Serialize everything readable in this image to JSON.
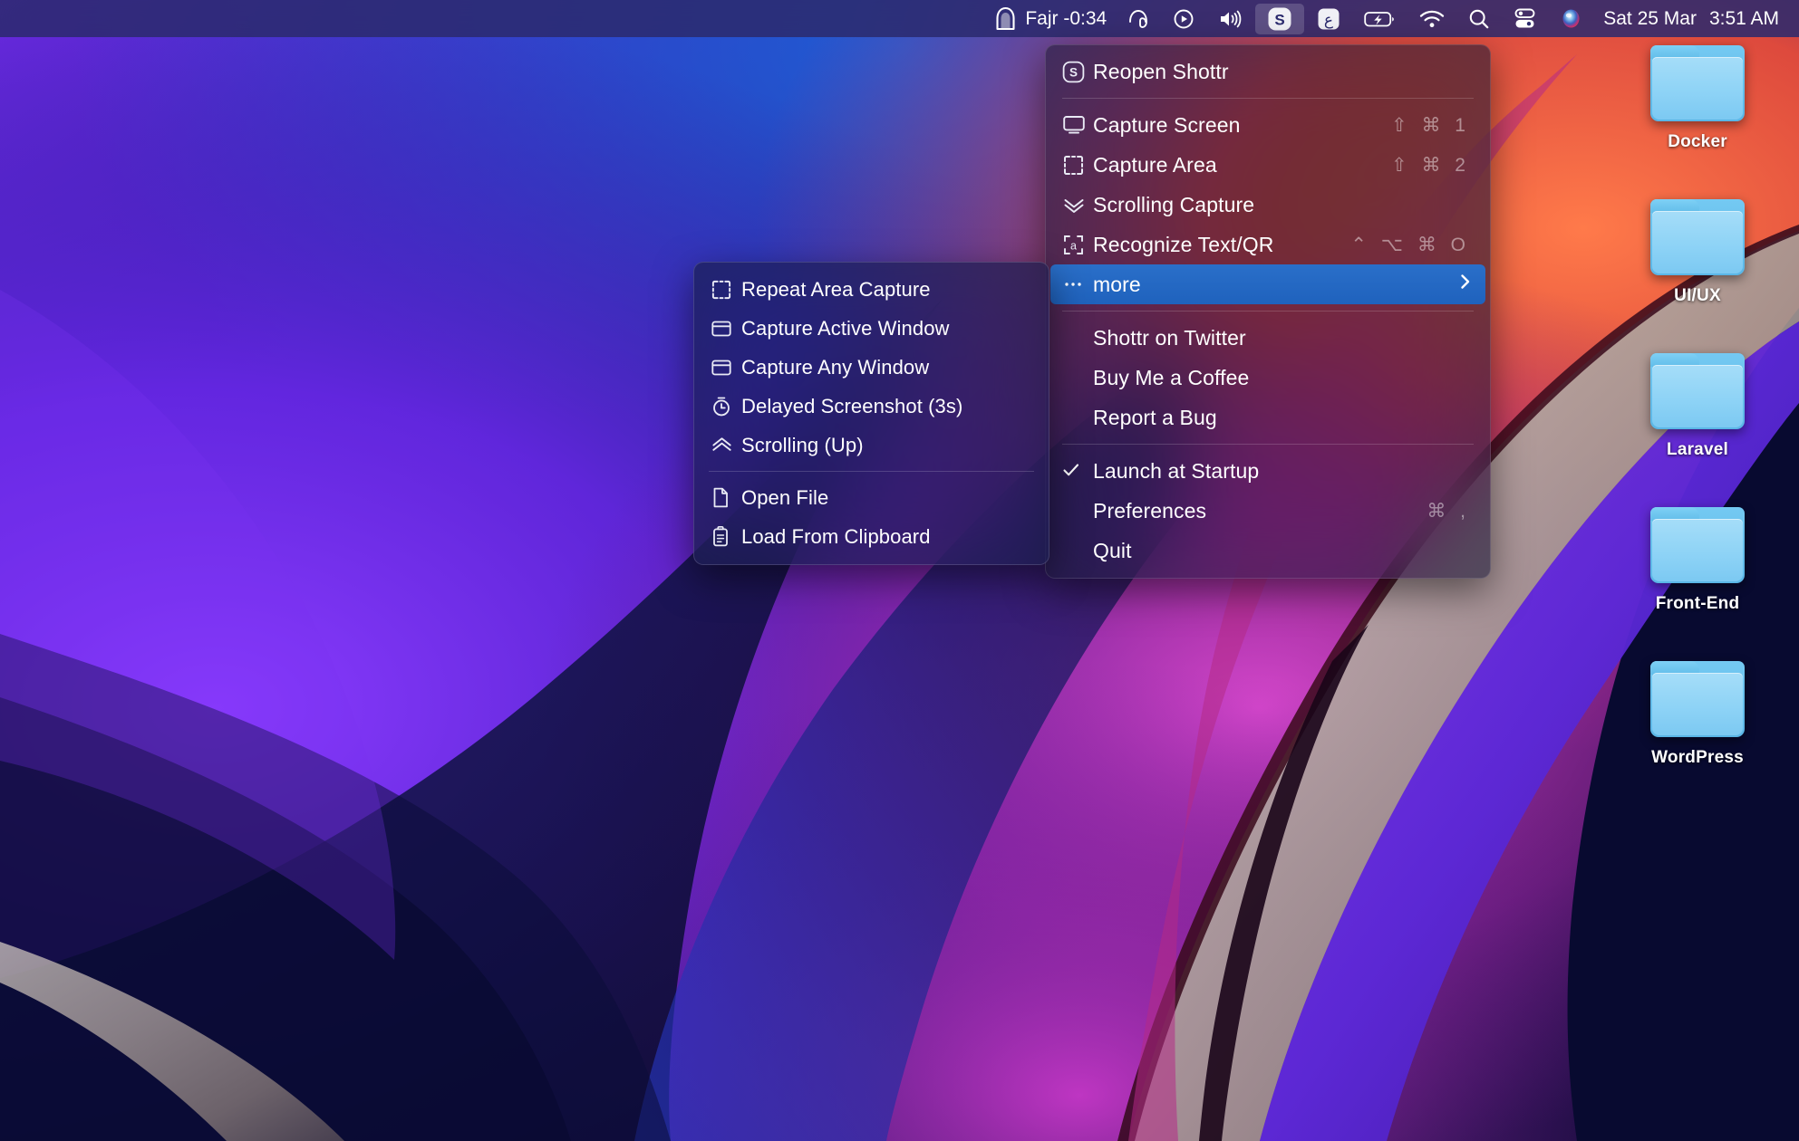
{
  "menubar": {
    "prayer": {
      "icon": "mosque-arch-icon",
      "label": "Fajr -0:34"
    },
    "icons": [
      {
        "name": "headphones-icon",
        "label": "headphones"
      },
      {
        "name": "play-circle-icon",
        "label": "play"
      },
      {
        "name": "volume-icon",
        "label": "volume"
      },
      {
        "name": "shottr-icon",
        "label": "S",
        "active": true
      },
      {
        "name": "arabic-ain-icon",
        "label": "ع"
      },
      {
        "name": "battery-charging-icon",
        "label": "battery"
      },
      {
        "name": "wifi-icon",
        "label": "wifi"
      },
      {
        "name": "spotlight-search-icon",
        "label": "search"
      },
      {
        "name": "control-center-icon",
        "label": "control center"
      },
      {
        "name": "siri-icon",
        "label": "siri"
      }
    ],
    "date": "Sat 25 Mar",
    "time": "3:51 AM"
  },
  "shottr_menu": {
    "items": [
      {
        "id": "reopen-shottr",
        "icon": "shottr-rounded-s-icon",
        "label": "Reopen Shottr",
        "shortcut": ""
      },
      {
        "id": "separator-1",
        "type": "separator"
      },
      {
        "id": "capture-screen",
        "icon": "display-icon",
        "label": "Capture Screen",
        "shortcut": "⇧ ⌘ 1"
      },
      {
        "id": "capture-area",
        "icon": "crop-marks-icon",
        "label": "Capture Area",
        "shortcut": "⇧ ⌘ 2"
      },
      {
        "id": "scrolling-capture",
        "icon": "chevron-double-down-icon",
        "label": "Scrolling Capture",
        "shortcut": ""
      },
      {
        "id": "recognize-text-qr",
        "icon": "text-recognition-icon",
        "label": "Recognize Text/QR",
        "shortcut": "⌃ ⌥ ⌘ O"
      },
      {
        "id": "more",
        "icon": "ellipsis-icon",
        "label": "more",
        "shortcut": "",
        "highlighted": true,
        "has_submenu": true
      },
      {
        "id": "separator-2",
        "type": "separator"
      },
      {
        "id": "shottr-on-twitter",
        "icon": "",
        "label": "Shottr on Twitter",
        "shortcut": ""
      },
      {
        "id": "buy-me-a-coffee",
        "icon": "",
        "label": "Buy Me a Coffee",
        "shortcut": ""
      },
      {
        "id": "report-a-bug",
        "icon": "",
        "label": "Report a Bug",
        "shortcut": ""
      },
      {
        "id": "separator-3",
        "type": "separator"
      },
      {
        "id": "launch-at-startup",
        "icon": "checkmark-icon",
        "label": "Launch at Startup",
        "shortcut": "",
        "checked": true
      },
      {
        "id": "preferences",
        "icon": "",
        "label": "Preferences",
        "shortcut": "⌘ ,"
      },
      {
        "id": "quit",
        "icon": "",
        "label": "Quit",
        "shortcut": ""
      }
    ]
  },
  "shottr_submenu": {
    "items": [
      {
        "id": "repeat-area-capture",
        "icon": "crop-marks-icon",
        "label": "Repeat Area Capture"
      },
      {
        "id": "capture-active-window",
        "icon": "window-icon",
        "label": "Capture Active Window"
      },
      {
        "id": "capture-any-window",
        "icon": "window-icon",
        "label": "Capture Any Window"
      },
      {
        "id": "delayed-screenshot",
        "icon": "timer-icon",
        "label": "Delayed Screenshot (3s)"
      },
      {
        "id": "scrolling-up",
        "icon": "chevron-double-up-icon",
        "label": "Scrolling (Up)"
      },
      {
        "id": "separator-1",
        "type": "separator"
      },
      {
        "id": "open-file",
        "icon": "document-icon",
        "label": "Open File"
      },
      {
        "id": "load-from-clipboard",
        "icon": "clipboard-icon",
        "label": "Load From Clipboard"
      }
    ]
  },
  "desktop": {
    "folders": [
      {
        "id": "folder-docker",
        "label": "Docker"
      },
      {
        "id": "folder-uiux",
        "label": "UI/UX"
      },
      {
        "id": "folder-laravel",
        "label": "Laravel"
      },
      {
        "id": "folder-frontend",
        "label": "Front-End"
      },
      {
        "id": "folder-wordpress",
        "label": "WordPress"
      }
    ]
  },
  "colors": {
    "menubar_bg": "#2b2a6e",
    "highlight_blue": "#2a6fc9",
    "folder_blue": "#8ed3f6",
    "wallpaper_purple": "#5b25d8",
    "wallpaper_magenta": "#d13ab5",
    "wallpaper_orange": "#ef5a3c",
    "wallpaper_deep": "#0a0b33"
  }
}
